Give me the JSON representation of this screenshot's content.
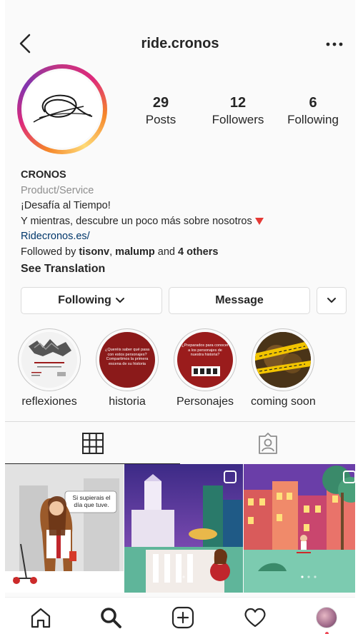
{
  "header": {
    "username": "ride.cronos",
    "back_icon": "chevron-left-icon",
    "more_icon": "more-horizontal-icon"
  },
  "stats": {
    "posts": {
      "value": "29",
      "label": "Posts"
    },
    "followers": {
      "value": "12",
      "label": "Followers"
    },
    "following": {
      "value": "6",
      "label": "Following"
    }
  },
  "bio": {
    "name": "CRONOS",
    "category": "Product/Service",
    "line1": "¡Desafía al Tiempo!",
    "line2": "Y mientras, descubre un poco más sobre nosotros",
    "link": "Ridecronos.es/",
    "followed_prefix": "Followed by ",
    "followed_user1": "tisonv",
    "followed_sep": ", ",
    "followed_user2": "malump",
    "followed_and": " and ",
    "followed_others": "4 others",
    "translate": "See Translation"
  },
  "actions": {
    "following": "Following",
    "message": "Message"
  },
  "highlights": [
    {
      "label": "reflexiones"
    },
    {
      "label": "historia",
      "text": "¿Queréis saber qué pasa con estos personajes? Compartimos la primera escena de su historia"
    },
    {
      "label": "Personajes",
      "text": "¿Preparados para conocer a los personajes de nuestra historia?"
    },
    {
      "label": "coming soon"
    }
  ],
  "posts": [
    {
      "caption": "Si supierais el día que tuve."
    },
    {
      "caption": ""
    },
    {
      "caption": ""
    }
  ],
  "colors": {
    "link": "#00376b",
    "secondary_text": "#8e8e8e",
    "border": "#dbdbdb",
    "historia_bg": "#8b1a1a",
    "personajes_bg": "#9a1c1c"
  }
}
